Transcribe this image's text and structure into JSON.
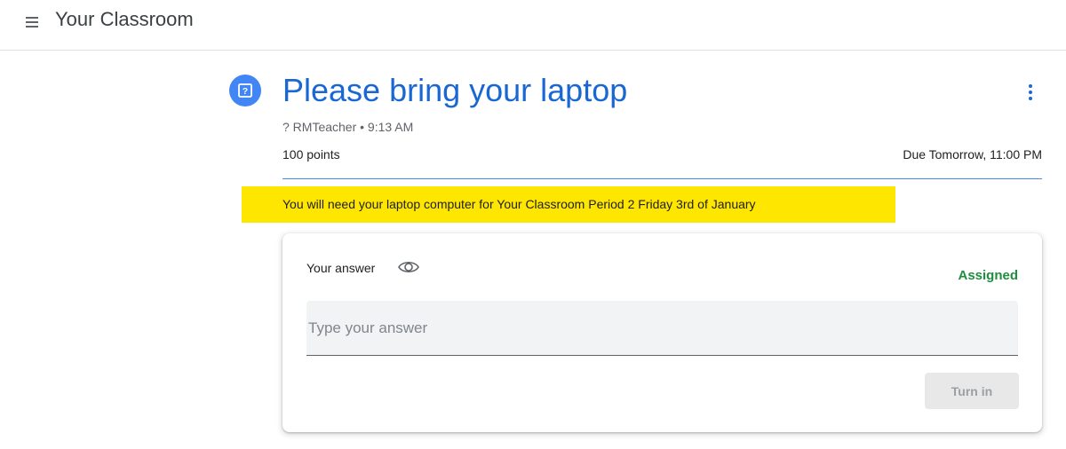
{
  "header": {
    "menu_icon": "hamburger-menu-icon",
    "title": "Your Classroom"
  },
  "assignment": {
    "type_icon": "question-icon",
    "title": "Please bring your laptop",
    "meta": "? RMTeacher • 9:13 AM",
    "points": "100 points",
    "due": "Due Tomorrow, 11:00 PM",
    "instructions": "You will need your laptop computer for Your Classroom Period 2 Friday 3rd of January",
    "highlight_color": "#ffe600",
    "accent_color": "#1967d2"
  },
  "answer_card": {
    "heading": "Your answer",
    "visibility_icon": "eye-icon",
    "status": "Assigned",
    "status_color": "#1e8e3e",
    "placeholder": "Type your answer",
    "value": "",
    "submit_label": "Turn in"
  }
}
